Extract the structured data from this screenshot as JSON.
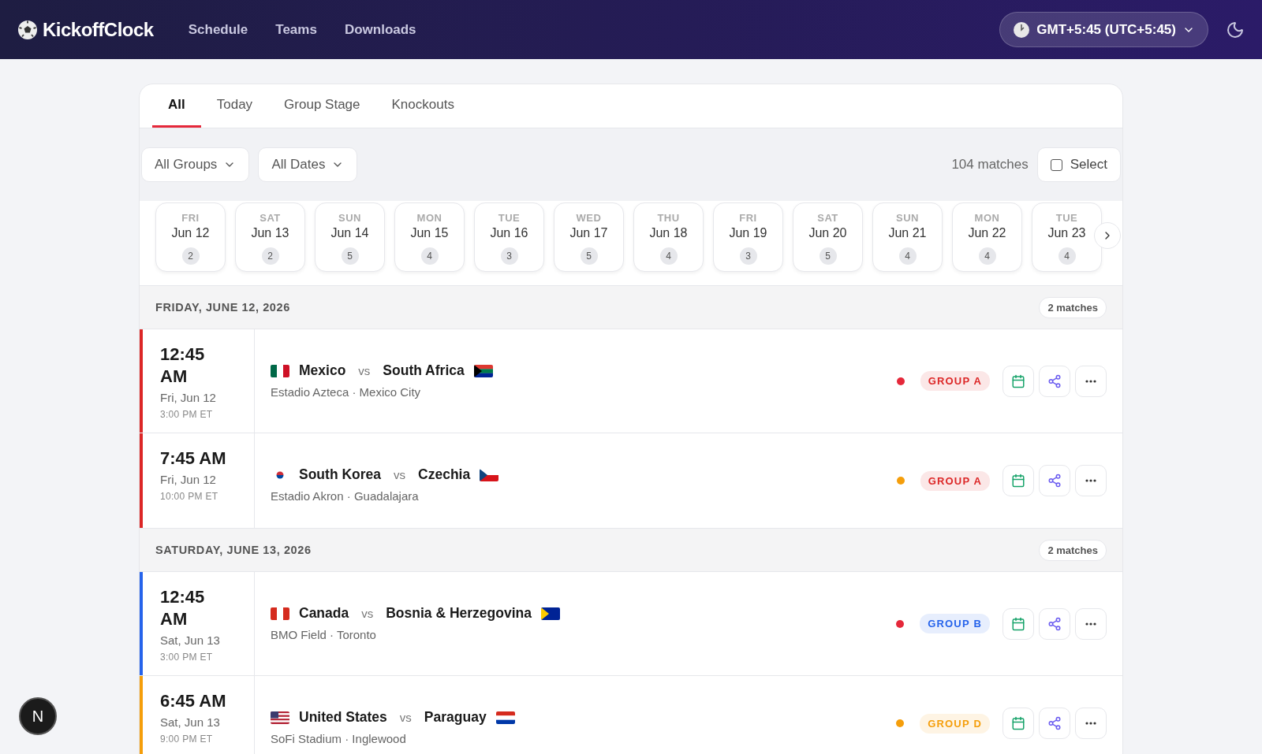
{
  "header": {
    "brand": "KickoffClock",
    "nav": [
      "Schedule",
      "Teams",
      "Downloads"
    ],
    "timezone": "GMT+5:45 (UTC+5:45)"
  },
  "tabs": [
    {
      "label": "All",
      "selected": true
    },
    {
      "label": "Today",
      "selected": false
    },
    {
      "label": "Group Stage",
      "selected": false
    },
    {
      "label": "Knockouts",
      "selected": false
    }
  ],
  "filters": {
    "groups": "All Groups",
    "dates": "All Dates",
    "count": "104 matches",
    "select": {
      "label": "Select",
      "checked": false
    }
  },
  "dates": [
    {
      "weekday": "FRI",
      "date": "Jun 12",
      "count": "2"
    },
    {
      "weekday": "SAT",
      "date": "Jun 13",
      "count": "2"
    },
    {
      "weekday": "SUN",
      "date": "Jun 14",
      "count": "5"
    },
    {
      "weekday": "MON",
      "date": "Jun 15",
      "count": "4"
    },
    {
      "weekday": "TUE",
      "date": "Jun 16",
      "count": "3"
    },
    {
      "weekday": "WED",
      "date": "Jun 17",
      "count": "5"
    },
    {
      "weekday": "THU",
      "date": "Jun 18",
      "count": "4"
    },
    {
      "weekday": "FRI",
      "date": "Jun 19",
      "count": "3"
    },
    {
      "weekday": "SAT",
      "date": "Jun 20",
      "count": "5"
    },
    {
      "weekday": "SUN",
      "date": "Jun 21",
      "count": "4"
    },
    {
      "weekday": "MON",
      "date": "Jun 22",
      "count": "4"
    },
    {
      "weekday": "TUE",
      "date": "Jun 23",
      "count": "4"
    }
  ],
  "sections": [
    {
      "title": "FRIDAY, JUNE 12, 2026",
      "count": "2 matches",
      "matches": [
        {
          "time": "12:45 AM",
          "day": "Fri, Jun 12",
          "et": "3:00 PM ET",
          "home": {
            "name": "Mexico",
            "kind": "mexico"
          },
          "vs": "vs",
          "away": {
            "name": "South Africa",
            "kind": "southafrica"
          },
          "venue": "Estadio Azteca · Mexico City",
          "dot": {
            "color": "#e5283a"
          },
          "group": "GROUP A",
          "color": "#dc2626"
        },
        {
          "time": "7:45 AM",
          "day": "Fri, Jun 12",
          "et": "10:00 PM ET",
          "home": {
            "name": "South Korea",
            "kind": "korea"
          },
          "vs": "vs",
          "away": {
            "name": "Czechia",
            "kind": "czechia"
          },
          "venue": "Estadio Akron · Guadalajara",
          "dot": {
            "color": "#f59e0b"
          },
          "group": "GROUP A",
          "color": "#dc2626"
        }
      ]
    },
    {
      "title": "SATURDAY, JUNE 13, 2026",
      "count": "2 matches",
      "matches": [
        {
          "time": "12:45 AM",
          "day": "Sat, Jun 13",
          "et": "3:00 PM ET",
          "home": {
            "name": "Canada",
            "kind": "canada"
          },
          "vs": "vs",
          "away": {
            "name": "Bosnia & Herzegovina",
            "kind": "bosnia"
          },
          "venue": "BMO Field · Toronto",
          "dot": {
            "color": "#e5283a"
          },
          "group": "GROUP B",
          "color": "#2563eb"
        },
        {
          "time": "6:45 AM",
          "day": "Sat, Jun 13",
          "et": "9:00 PM ET",
          "home": {
            "name": "United States",
            "kind": "usa"
          },
          "vs": "vs",
          "away": {
            "name": "Paraguay",
            "kind": "paraguay"
          },
          "venue": "SoFi Stadium · Inglewood",
          "dot": {
            "color": "#f59e0b"
          },
          "group": "GROUP D",
          "color": "#f59e0b"
        }
      ]
    }
  ],
  "dev_badge": "N"
}
